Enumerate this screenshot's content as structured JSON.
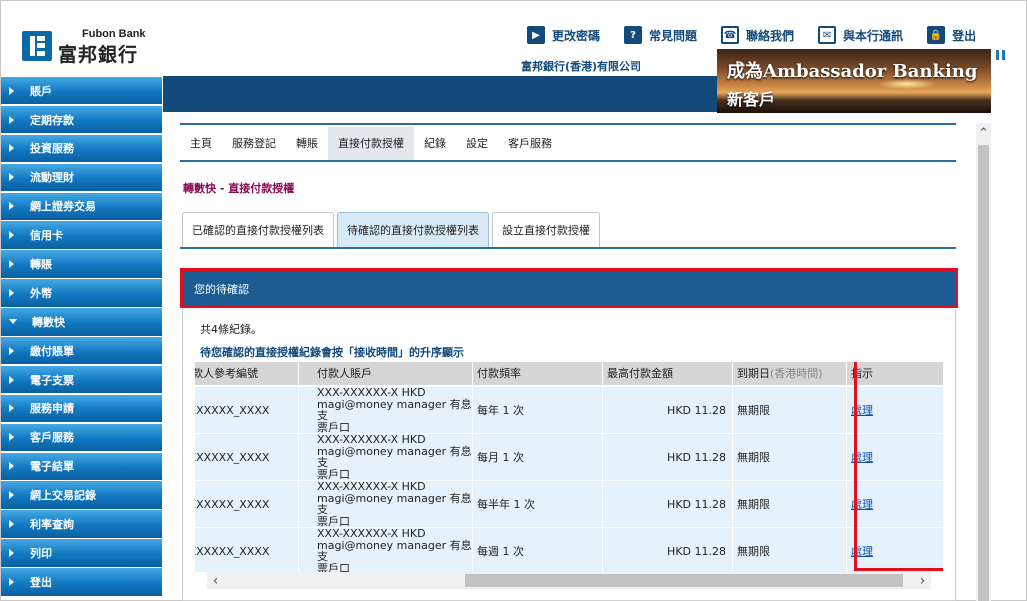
{
  "header": {
    "logo_en": "Fubon Bank",
    "logo_zh": "富邦銀行",
    "company": "富邦銀行(香港)有限公司",
    "topnav": [
      {
        "label": "更改密碼",
        "icon": "play-icon",
        "glyph": "▶"
      },
      {
        "label": "常見問題",
        "icon": "question-icon",
        "glyph": "?"
      },
      {
        "label": "聯絡我們",
        "icon": "phone-icon",
        "glyph": "☎"
      },
      {
        "label": "與本行通訊",
        "icon": "mail-icon",
        "glyph": "✉"
      },
      {
        "label": "登出",
        "icon": "lock-icon",
        "glyph": "🔒"
      }
    ],
    "banner": {
      "line1": "成為Ambassador Banking",
      "line2": "新客戶"
    }
  },
  "sidebar": {
    "items": [
      {
        "label": "賬戶",
        "expanded": false
      },
      {
        "label": "定期存款",
        "expanded": false
      },
      {
        "label": "投資服務",
        "expanded": false
      },
      {
        "label": "流動理財",
        "expanded": false
      },
      {
        "label": "網上證券交易",
        "expanded": false
      },
      {
        "label": "信用卡",
        "expanded": false
      },
      {
        "label": "轉賬",
        "expanded": false
      },
      {
        "label": "外幣",
        "expanded": false
      },
      {
        "label": "轉數快",
        "expanded": true
      },
      {
        "label": "繳付賬單",
        "expanded": false
      },
      {
        "label": "電子支票",
        "expanded": false
      },
      {
        "label": "服務申請",
        "expanded": false
      },
      {
        "label": "客戶服務",
        "expanded": false
      },
      {
        "label": "電子結單",
        "expanded": false
      },
      {
        "label": "網上交易記錄",
        "expanded": false
      },
      {
        "label": "利率查詢",
        "expanded": false
      },
      {
        "label": "列印",
        "expanded": false
      },
      {
        "label": "登出",
        "expanded": false
      }
    ]
  },
  "mainnav": {
    "items": [
      "主頁",
      "服務登記",
      "轉賬",
      "直接付款授權",
      "紀錄",
      "設定",
      "客戶服務"
    ],
    "active": 3
  },
  "breadcrumb": "轉數快 - 直接付款授權",
  "subtabs": {
    "items": [
      "已確認的直接付款授權列表",
      "待確認的直接付款授權列表",
      "設立直接付款授權"
    ],
    "active": 1
  },
  "pending": {
    "title": "您的待確認",
    "count_text": "共4條紀錄。",
    "note": "待您確認的直接授權紀錄會按「接收時間」的升序顯示"
  },
  "table": {
    "headers": {
      "ref": "付款人參考編號",
      "account": "付款人賬戶",
      "freq": "付款頻率",
      "max": "最高付款金額",
      "expiry": "到期日",
      "expiry_note": "(香港時間)",
      "action": "指示"
    },
    "rows": [
      {
        "ref": "XXXXXXX_XXXX",
        "acct1": "XXX-XXXXXX-X HKD",
        "acct2": "magi@money manager 有息支",
        "acct3": "票戶口",
        "freq": "每年 1 次",
        "max": "HKD  11.28",
        "expiry": "無期限",
        "action": "處理"
      },
      {
        "ref": "XXXXXXX_XXXX",
        "acct1": "XXX-XXXXXX-X HKD",
        "acct2": "magi@money manager 有息支",
        "acct3": "票戶口",
        "freq": "每月 1 次",
        "max": "HKD  11.28",
        "expiry": "無期限",
        "action": "處理"
      },
      {
        "ref": "XXXXXXX_XXXX",
        "acct1": "XXX-XXXXXX-X HKD",
        "acct2": "magi@money manager 有息支",
        "acct3": "票戶口",
        "freq": "每半年 1 次",
        "max": "HKD  11.28",
        "expiry": "無期限",
        "action": "處理"
      },
      {
        "ref": "XXXXXXX_XXXX",
        "acct1": "XXX-XXXXXX-X HKD",
        "acct2": "magi@money manager 有息支",
        "acct3": "票戶口",
        "freq": "每週 1 次",
        "max": "HKD  11.28",
        "expiry": "無期限",
        "action": "處理"
      }
    ]
  },
  "colors": {
    "brand_blue": "#124a7c",
    "highlight_red": "#e01020",
    "row_bg": "#e6f2fb"
  }
}
